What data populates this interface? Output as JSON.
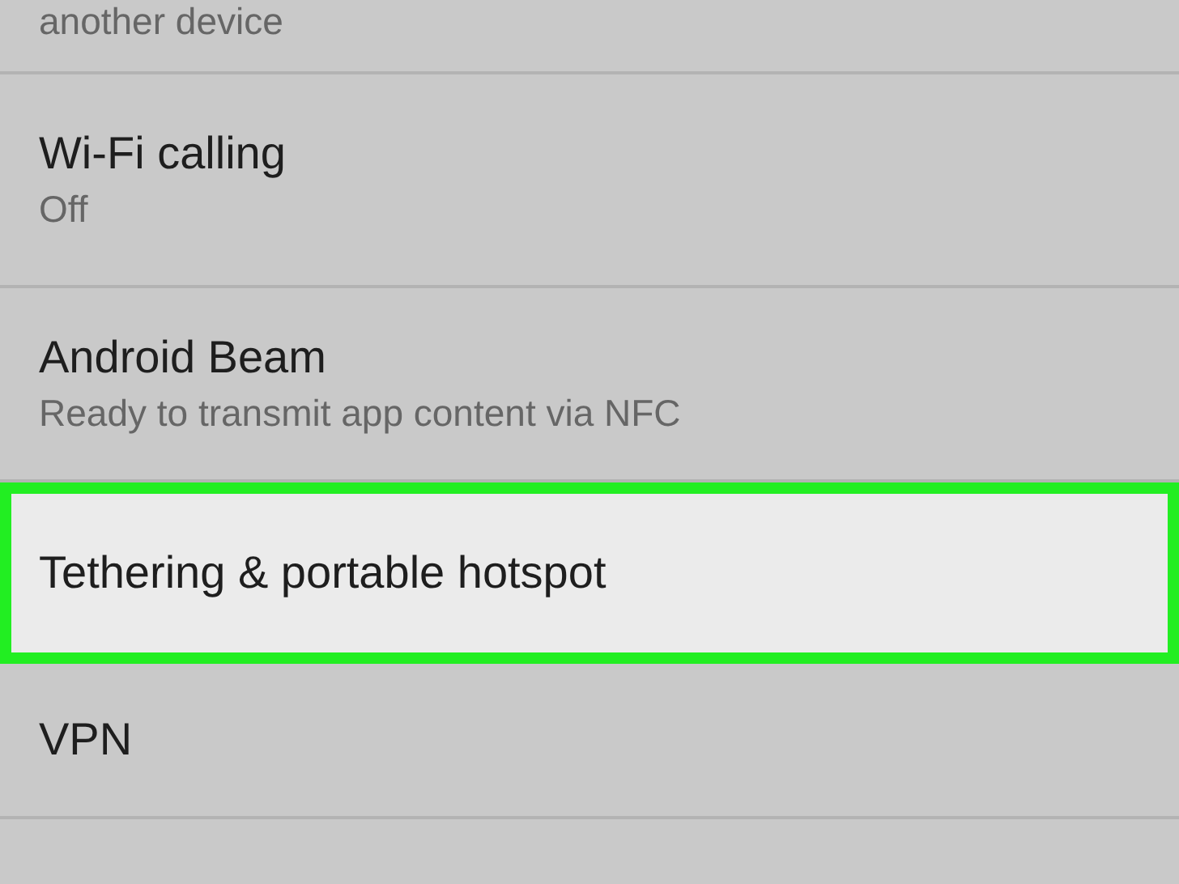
{
  "settings_list": {
    "cut_off_subtitle": "another device",
    "items": [
      {
        "title": "Wi-Fi calling",
        "subtitle": "Off",
        "selected": false
      },
      {
        "title": "Android Beam",
        "subtitle": "Ready to transmit app content via NFC",
        "selected": false
      },
      {
        "title": "Tethering & portable hotspot",
        "selected": true
      },
      {
        "title": "VPN",
        "selected": false
      }
    ]
  }
}
